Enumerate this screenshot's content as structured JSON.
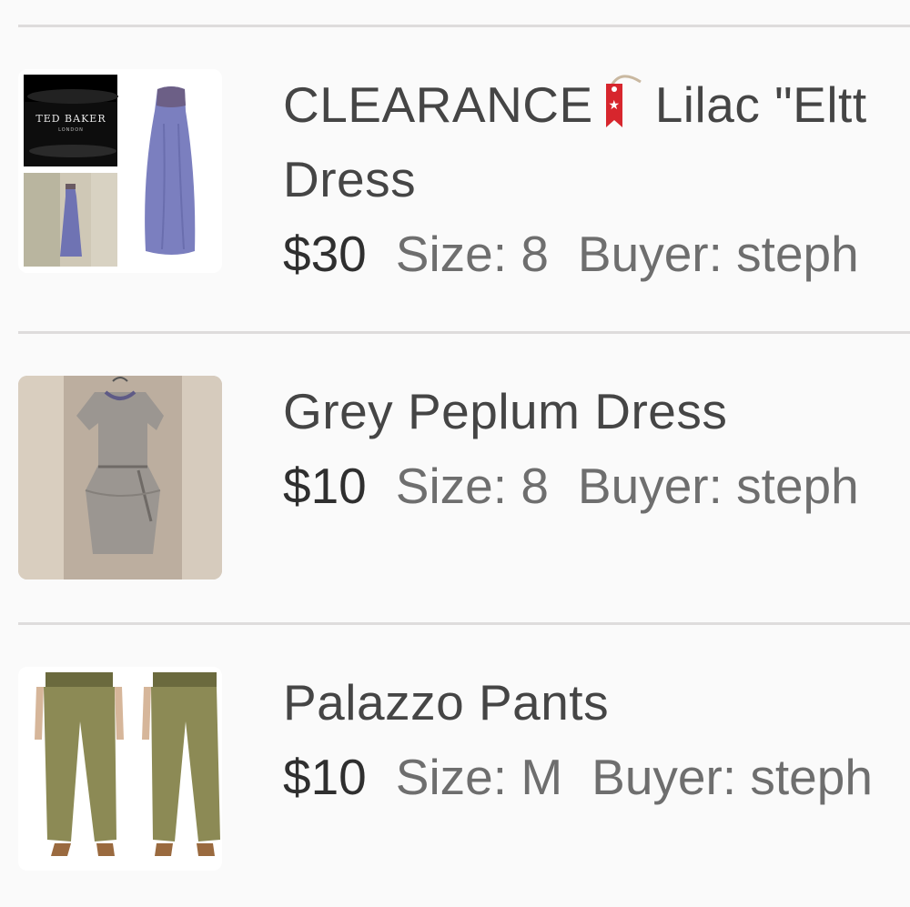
{
  "listings": [
    {
      "title_prefix": "CLEARANCE",
      "tag_icon": "red-tag-icon",
      "title_rest": "Lilac \"Eltt",
      "title_line2": "Dress",
      "price": "$30",
      "size": "Size: 8",
      "buyer": "Buyer: steph",
      "thumb_logo_text": "TED BAKER",
      "thumb_logo_sub": "LONDON"
    },
    {
      "title": "Grey Peplum Dress",
      "price": "$10",
      "size": "Size: 8",
      "buyer": "Buyer: steph"
    },
    {
      "title": "Palazzo Pants",
      "price": "$10",
      "size": "Size: M",
      "buyer": "Buyer: steph"
    }
  ],
  "colors": {
    "background": "#fafafa",
    "divider": "#dedcdc",
    "tag_red": "#d7262d",
    "dress_lilac": "#7b7fbf",
    "dress_grey": "#9b9691",
    "pants_olive": "#8c8a55"
  }
}
